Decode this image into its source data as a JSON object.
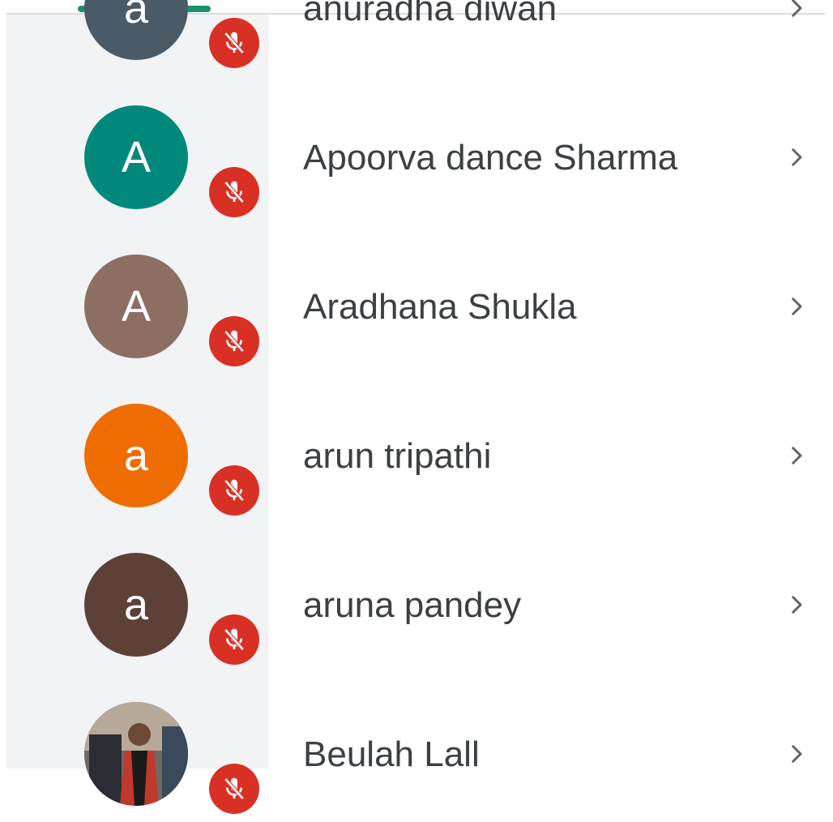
{
  "participants": [
    {
      "name": "anuradha diwan",
      "initial": "a",
      "avatar_color": "#4a5a66",
      "muted": true
    },
    {
      "name": "Apoorva dance Sharma",
      "initial": "A",
      "avatar_color": "#00897b",
      "muted": true
    },
    {
      "name": "Aradhana Shukla",
      "initial": "A",
      "avatar_color": "#8d6e63",
      "muted": true
    },
    {
      "name": "arun tripathi",
      "initial": "a",
      "avatar_color": "#ef6c00",
      "muted": true
    },
    {
      "name": "aruna pandey",
      "initial": "a",
      "avatar_color": "#5d4037",
      "muted": true
    },
    {
      "name": "Beulah Lall",
      "initial": "",
      "avatar_color": "#9e9e9e",
      "muted": true,
      "has_photo": true
    }
  ],
  "icons": {
    "mute": "mic-off-icon",
    "chevron": "chevron-right-icon"
  },
  "colors": {
    "accent": "#1e8e6e",
    "muted_badge": "#d93025",
    "sidebar": "#f1f3f4",
    "text": "#3c4043"
  }
}
